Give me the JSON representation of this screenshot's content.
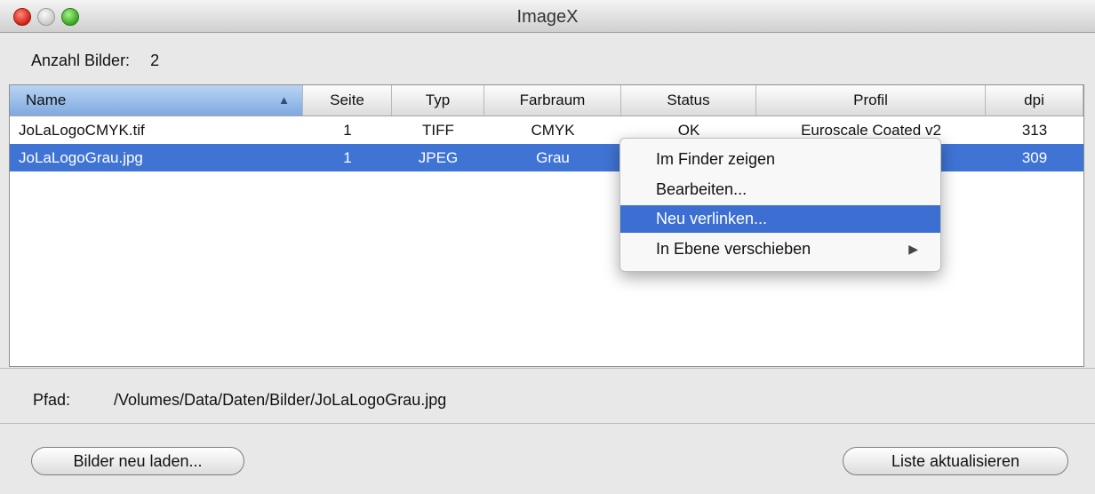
{
  "window": {
    "title": "ImageX"
  },
  "summary": {
    "label": "Anzahl Bilder:",
    "value": "2"
  },
  "table": {
    "headers": [
      "Name",
      "Seite",
      "Typ",
      "Farbraum",
      "Status",
      "Profil",
      "dpi"
    ],
    "rows": [
      [
        "JoLaLogoCMYK.tif",
        "1",
        "TIFF",
        "CMYK",
        "OK",
        "Euroscale Coated v2",
        "313"
      ],
      [
        "JoLaLogoGrau.jpg",
        "1",
        "JPEG",
        "Grau",
        "",
        "",
        "309"
      ]
    ],
    "selected_row_index": 1,
    "sort": {
      "column": "Name",
      "direction": "ascending"
    }
  },
  "context_menu": {
    "items": [
      "Im Finder zeigen",
      "Bearbeiten...",
      "Neu verlinken...",
      "In Ebene verschieben"
    ],
    "highlighted_index": 2,
    "submenu_item_index": 3
  },
  "path": {
    "label": "Pfad:",
    "value": "/Volumes/Data/Daten/Bilder/JoLaLogoGrau.jpg"
  },
  "buttons": {
    "reload": "Bilder neu laden...",
    "refresh": "Liste aktualisieren"
  },
  "colors": {
    "selection": "#3f74d4",
    "menu_highlight": "#3c6fd1",
    "header_sorted": "#9bc0ea"
  }
}
